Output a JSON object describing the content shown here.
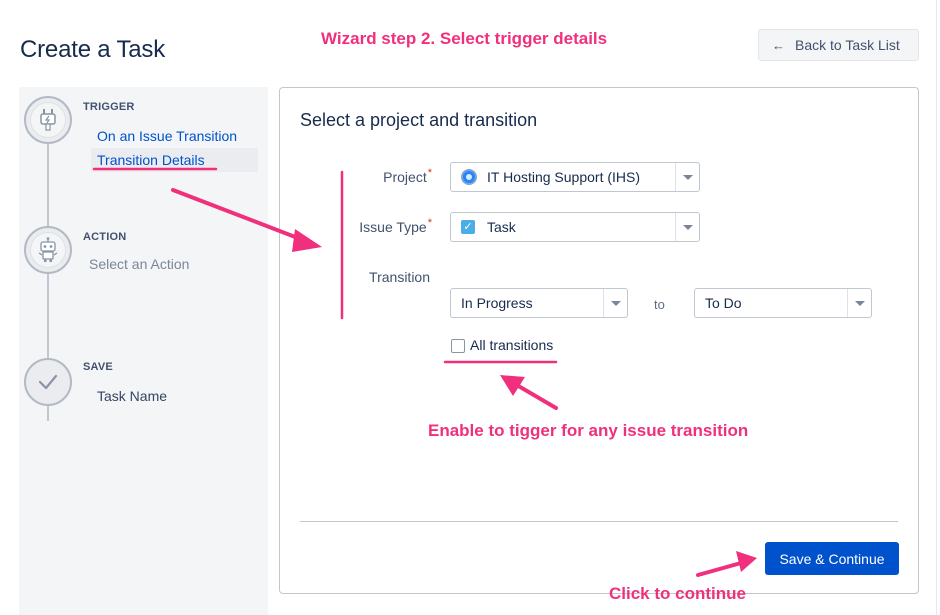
{
  "page": {
    "title": "Create a Task",
    "back_button": {
      "arrow": "←",
      "label": "Back to Task List"
    }
  },
  "sidebar": {
    "steps": [
      {
        "heading": "TRIGGER",
        "icon": "plug-icon",
        "items": [
          "On an Issue Transition",
          "Transition Details"
        ],
        "active_item": "Transition Details"
      },
      {
        "heading": "ACTION",
        "icon": "robot-icon",
        "items": [
          "Select an Action"
        ]
      },
      {
        "heading": "SAVE",
        "icon": "check-icon",
        "items": [
          "Task Name"
        ]
      }
    ]
  },
  "form": {
    "title": "Select a project and transition",
    "project": {
      "label": "Project",
      "required_mark": "*",
      "value": "IT Hosting Support (IHS)"
    },
    "issue_type": {
      "label": "Issue Type",
      "required_mark": "*",
      "value": "Task",
      "icon_glyph": "✓"
    },
    "transition": {
      "label": "Transition",
      "from": "In Progress",
      "connector": "to",
      "to": "To Do"
    },
    "all_transitions": {
      "label": "All transitions",
      "checked": false
    },
    "save_button": "Save & Continue"
  },
  "annotations": {
    "top": "Wizard step 2. Select trigger details",
    "middle": "Enable to tigger for any issue transition",
    "bottom": "Click to continue"
  },
  "colors": {
    "annotation": "#f0307d",
    "primary": "#0052cc",
    "link": "#0052cc",
    "required": "#de350b",
    "sidebar_bg": "#f4f5f7"
  }
}
